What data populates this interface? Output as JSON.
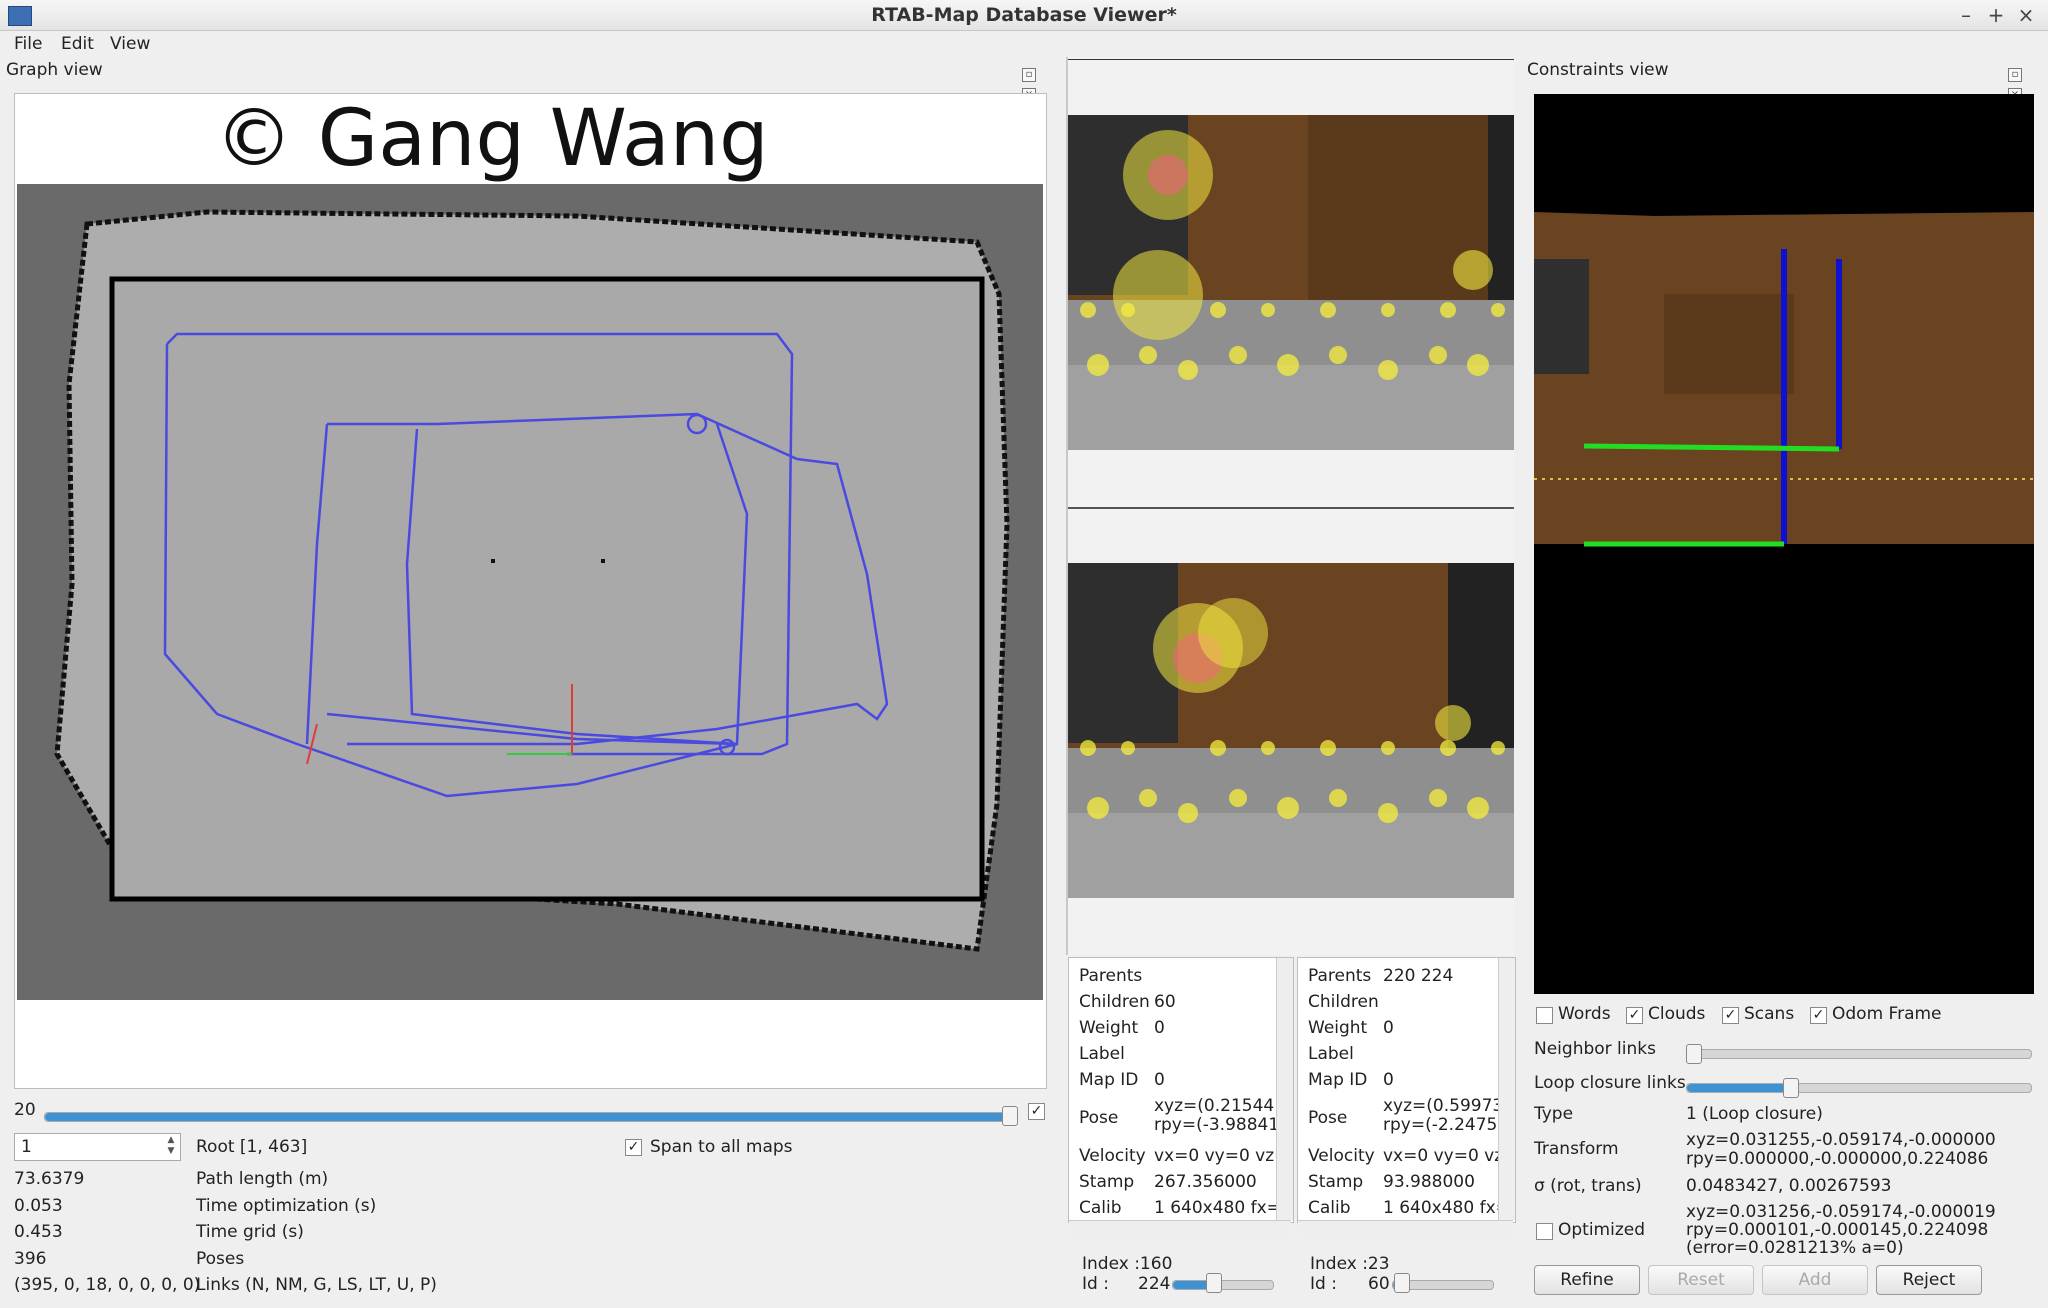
{
  "window": {
    "title": "RTAB-Map Database Viewer*"
  },
  "menu": [
    "File",
    "Edit",
    "View"
  ],
  "graph_view": {
    "title": "Graph view",
    "watermark": "© Gang Wang",
    "slider_value": "20",
    "root_input": "1",
    "root_label": "Root [1, 463]",
    "span_label": "Span to all maps",
    "stats": [
      {
        "value": "73.6379",
        "label": "Path length (m)"
      },
      {
        "value": "0.053",
        "label": "Time optimization (s)"
      },
      {
        "value": "0.453",
        "label": "Time grid (s)"
      },
      {
        "value": "396",
        "label": "Poses"
      },
      {
        "value": "(395, 0, 18, 0, 0, 0, 0)",
        "label": "Links (N, NM, G, LS, LT, U, P)"
      }
    ]
  },
  "node_left": {
    "parents_k": "Parents",
    "parents_v": "",
    "children_k": "Children",
    "children_v": "60",
    "weight_k": "Weight",
    "weight_v": "0",
    "label_k": "Label",
    "label_v": "",
    "mapid_k": "Map ID",
    "mapid_v": "0",
    "pose_k": "Pose",
    "pose_v1": "xyz=(0.215441",
    "pose_v2": "rpy=(-3.98841€",
    "vel_k": "Velocity",
    "vel_v": "vx=0 vy=0 vz=",
    "stamp_k": "Stamp",
    "stamp_v": "267.356000",
    "calib_k": "Calib",
    "calib_v": "1 640x480 fx=:",
    "index_label": "Index :160",
    "id_label": "Id :",
    "id_value": "224"
  },
  "node_right": {
    "parents_k": "Parents",
    "parents_v": "220 224",
    "children_k": "Children",
    "children_v": "",
    "weight_k": "Weight",
    "weight_v": "0",
    "label_k": "Label",
    "label_v": "",
    "mapid_k": "Map ID",
    "mapid_v": "0",
    "pose_k": "Pose",
    "pose_v1": "xyz=(0.59973",
    "pose_v2": "rpy=(-2.24759",
    "vel_k": "Velocity",
    "vel_v": "vx=0 vy=0 vz",
    "stamp_k": "Stamp",
    "stamp_v": "93.988000",
    "calib_k": "Calib",
    "calib_v": "1 640x480 fx=",
    "index_label": "Index :23",
    "id_label": "Id :",
    "id_value": "60"
  },
  "constraints": {
    "title": "Constraints view",
    "checks": [
      {
        "label": "Words",
        "checked": ""
      },
      {
        "label": "Clouds",
        "checked": "✓"
      },
      {
        "label": "Scans",
        "checked": "✓"
      },
      {
        "label": "Odom Frame",
        "checked": "✓"
      }
    ],
    "neighbor_links": "Neighbor links",
    "loop_closure_links": "Loop closure links",
    "loop_closure_slider": 0.3,
    "type_k": "Type",
    "type_v": "1 (Loop closure)",
    "transform_k": "Transform",
    "transform_v1": "xyz=0.031255,-0.059174,-0.000000",
    "transform_v2": "rpy=0.000000,-0.000000,0.224086",
    "sigma_k": "σ (rot, trans)",
    "sigma_v": "0.0483427, 0.00267593",
    "optimized_k": "Optimized",
    "optimized_v1": "xyz=0.031256,-0.059174,-0.000019",
    "optimized_v2": "rpy=0.000101,-0.000145,0.224098",
    "optimized_v3": "(error=0.0281213% a=0)",
    "buttons": [
      "Refine",
      "Reset",
      "Add",
      "Reject"
    ]
  },
  "colors": {
    "trajectory": "#4a4ae0",
    "map_bg": "#6a6a6a",
    "free_space": "#adadad",
    "accent": "#3f92d2"
  }
}
